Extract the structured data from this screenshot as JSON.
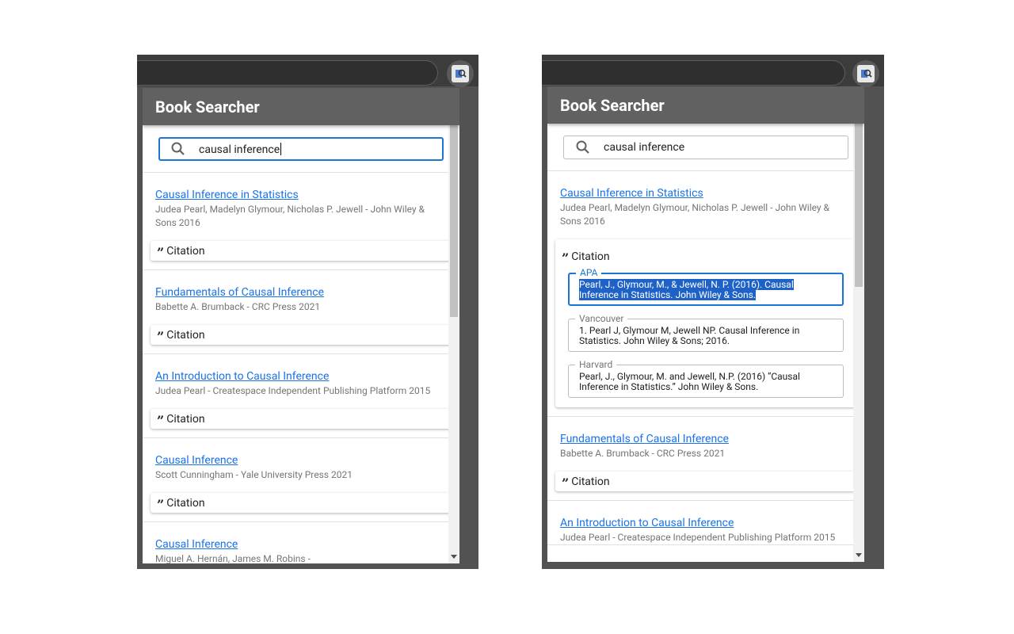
{
  "app": {
    "title": "Book Searcher"
  },
  "search": {
    "query": "causal inference"
  },
  "citation_label": "Citation",
  "left": {
    "results": [
      {
        "title": "Causal Inference in Statistics",
        "meta": "Judea Pearl, Madelyn Glymour, Nicholas P. Jewell - John Wiley & Sons 2016"
      },
      {
        "title": "Fundamentals of Causal Inference",
        "meta": "Babette A. Brumback - CRC Press 2021"
      },
      {
        "title": "An Introduction to Causal Inference",
        "meta": "Judea Pearl - Createspace Independent Publishing Platform 2015"
      },
      {
        "title": "Causal Inference",
        "meta": "Scott Cunningham - Yale University Press 2021"
      },
      {
        "title": "Causal Inference",
        "meta": "Miguel A. Hernán, James M. Robins -"
      }
    ]
  },
  "right": {
    "results": [
      {
        "title": "Causal Inference in Statistics",
        "meta": "Judea Pearl, Madelyn Glymour, Nicholas P. Jewell - John Wiley & Sons 2016"
      },
      {
        "title": "Fundamentals of Causal Inference",
        "meta": "Babette A. Brumback - CRC Press 2021"
      },
      {
        "title": "An Introduction to Causal Inference",
        "meta": "Judea Pearl - Createspace Independent Publishing Platform 2015"
      }
    ],
    "citations": {
      "apa": {
        "label": "APA",
        "text": "Pearl, J., Glymour, M., & Jewell, N. P. (2016). Causal Inference in Statistics. John Wiley & Sons."
      },
      "vancouver": {
        "label": "Vancouver",
        "text": "1.  Pearl J, Glymour M, Jewell NP. Causal Inference in Statistics. John Wiley & Sons; 2016."
      },
      "harvard": {
        "label": "Harvard",
        "text": "Pearl, J., Glymour, M. and Jewell, N.P. (2016) “Causal Inference in Statistics.” John Wiley & Sons."
      }
    }
  },
  "icons": {
    "search": "search-icon",
    "quote": "format-quote-icon",
    "extension": "book-search-extension-icon"
  },
  "colors": {
    "header": "#616161",
    "link": "#1a73e8",
    "focus": "#1976d2",
    "selection": "#1e62c8"
  }
}
